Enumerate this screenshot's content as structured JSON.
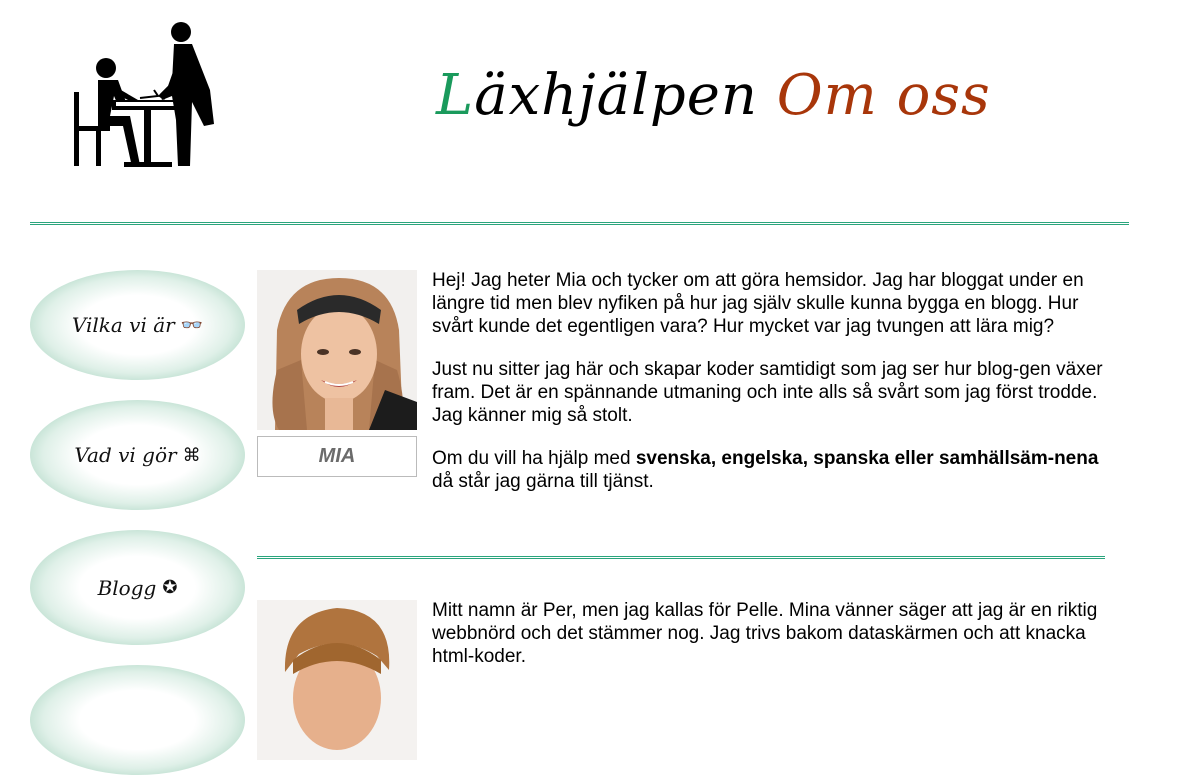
{
  "header": {
    "title_first_letter": "L",
    "title_rest": "äxhjälpen",
    "page_name": "Om oss"
  },
  "nav": {
    "items": [
      {
        "label": "Vilka vi är",
        "icon": "👓"
      },
      {
        "label": "Vad vi gör",
        "icon": "⌘"
      },
      {
        "label": "Blogg",
        "icon": "✪"
      },
      {
        "label": "",
        "icon": ""
      }
    ]
  },
  "profiles": [
    {
      "name": "MIA",
      "paragraphs": [
        "Hej! Jag heter Mia och tycker om att göra hemsidor. Jag har bloggat under en längre tid men blev nyfiken på hur jag själv skulle kunna bygga en blogg. Hur svårt kunde det egentligen vara? Hur mycket var jag tvungen att lära mig?",
        "Just nu sitter jag här och skapar koder samtidigt som jag ser hur blog-gen växer fram. Det är en spännande utmaning och inte alls så svårt som jag först trodde. Jag känner mig så stolt."
      ],
      "help_prefix": "Om du vill ha hjälp med ",
      "help_subjects": "svenska, engelska, spanska eller samhällsäm-nena",
      "help_suffix": " då står jag gärna till tjänst."
    },
    {
      "name": "",
      "paragraphs": [
        "Mitt namn är Per, men jag kallas för Pelle. Mina vänner säger att jag är en riktig webbnörd och det stämmer nog. Jag trivs bakom dataskärmen och att knacka html-koder."
      ]
    }
  ],
  "colors": {
    "title_green": "#1a9a5c",
    "title_rust": "#a8360a",
    "rule_green": "#2aa57d"
  }
}
